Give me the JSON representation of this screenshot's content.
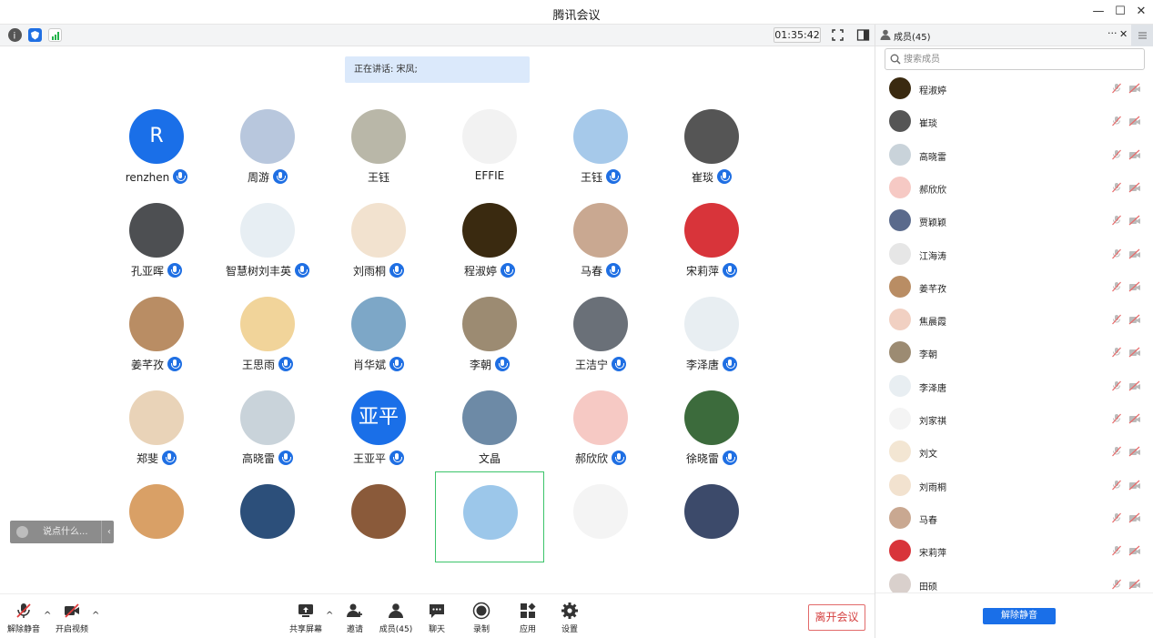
{
  "window": {
    "title": "腾讯会议"
  },
  "toolbar": {
    "timer": "01:35:42"
  },
  "speaking": {
    "label": "正在讲话: 宋凤;"
  },
  "colors": {
    "accent": "#1f6fe3",
    "leave": "#d54040",
    "selected_border": "#3cc46a"
  },
  "tiles": [
    {
      "name": "renzhen",
      "mic": true,
      "letter": "R",
      "color": "#1a6fe8"
    },
    {
      "name": "周游",
      "mic": true,
      "color": "#b8c7dd"
    },
    {
      "name": "王钰",
      "mic": false,
      "color": "#b9b7a8"
    },
    {
      "name": "EFFIE",
      "mic": false,
      "color": "#f2f2f2"
    },
    {
      "name": "王钰",
      "mic": true,
      "color": "#a6c9ea"
    },
    {
      "name": "崔琰",
      "mic": true,
      "color": "#555555"
    },
    {
      "name": "孔亚晖",
      "mic": true,
      "color": "#4d4f52"
    },
    {
      "name": "智慧树刘丰英",
      "mic": true,
      "color": "#e7eef3"
    },
    {
      "name": "刘雨桐",
      "mic": true,
      "color": "#f2e2cf"
    },
    {
      "name": "程淑婷",
      "mic": true,
      "color": "#3a2a10"
    },
    {
      "name": "马春",
      "mic": true,
      "color": "#c9a891"
    },
    {
      "name": "宋莉萍",
      "mic": true,
      "color": "#d8343a"
    },
    {
      "name": "姜芊孜",
      "mic": true,
      "color": "#b98d64"
    },
    {
      "name": "王思雨",
      "mic": true,
      "color": "#f1d49a"
    },
    {
      "name": "肖华斌",
      "mic": true,
      "color": "#7da7c7"
    },
    {
      "name": "李朝",
      "mic": true,
      "color": "#9c8b72"
    },
    {
      "name": "王洁宁",
      "mic": true,
      "color": "#6a7078"
    },
    {
      "name": "李泽唐",
      "mic": true,
      "color": "#e8eef2"
    },
    {
      "name": "郑斐",
      "mic": true,
      "color": "#e9d3b8"
    },
    {
      "name": "高晓雷",
      "mic": true,
      "color": "#c9d3da"
    },
    {
      "name": "王亚平",
      "mic": true,
      "letter": "亚平",
      "color": "#1a6fe8"
    },
    {
      "name": "文晶",
      "mic": false,
      "color": "#6d8aa6"
    },
    {
      "name": "郝欣欣",
      "mic": true,
      "color": "#f6c9c4"
    },
    {
      "name": "徐晓雷",
      "mic": true,
      "color": "#3c6b3c"
    },
    {
      "name": "",
      "mic": false,
      "color": "#d9a066"
    },
    {
      "name": "",
      "mic": false,
      "color": "#2c4f7a"
    },
    {
      "name": "",
      "mic": false,
      "color": "#8a5a3a"
    },
    {
      "name": "",
      "mic": false,
      "color": "#9cc7ea",
      "selected": true
    },
    {
      "name": "",
      "mic": false,
      "color": "#f4f4f4"
    },
    {
      "name": "",
      "mic": false,
      "color": "#3c4a6a"
    }
  ],
  "chat": {
    "placeholder": "说点什么...",
    "collapse": "‹"
  },
  "bottom": {
    "unmute": "解除静音",
    "video": "开启视频",
    "share": "共享屏幕",
    "invite": "邀请",
    "members": "成员(45)",
    "chat": "聊天",
    "record": "录制",
    "apps": "应用",
    "settings": "设置",
    "leave": "离开会议"
  },
  "panel": {
    "title": "成员(45)",
    "search_placeholder": "搜索成员",
    "more": "···",
    "close": "✕",
    "unmute_all": "解除静音",
    "members": [
      {
        "name": "程淑婷",
        "color": "#3a2a10"
      },
      {
        "name": "崔琰",
        "color": "#555555"
      },
      {
        "name": "高晓雷",
        "color": "#c9d3da"
      },
      {
        "name": "郝欣欣",
        "color": "#f6c9c4"
      },
      {
        "name": "贾颖颖",
        "color": "#5a6a8c"
      },
      {
        "name": "江海涛",
        "color": "#e6e6e6"
      },
      {
        "name": "姜芊孜",
        "color": "#b98d64"
      },
      {
        "name": "焦晨霞",
        "color": "#f1d0c2"
      },
      {
        "name": "李朝",
        "color": "#9c8b72"
      },
      {
        "name": "李泽唐",
        "color": "#e8eef2"
      },
      {
        "name": "刘家祺",
        "color": "#f4f4f4"
      },
      {
        "name": "刘文",
        "color": "#f3e6d3"
      },
      {
        "name": "刘雨桐",
        "color": "#f2e2cf"
      },
      {
        "name": "马春",
        "color": "#c9a891"
      },
      {
        "name": "宋莉萍",
        "color": "#d8343a"
      },
      {
        "name": "田硕",
        "color": "#d9d0cc"
      }
    ]
  }
}
